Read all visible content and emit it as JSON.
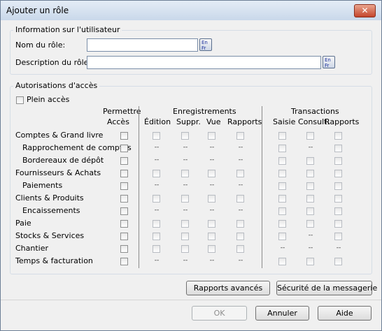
{
  "window": {
    "title": "Ajouter un rôle",
    "close_label": "✕"
  },
  "user_info": {
    "legend": "Information sur l'utilisateur",
    "role_name_label": "Nom du rôle:",
    "role_name_value": "",
    "role_desc_label": "Description du rôle:",
    "role_desc_value": "",
    "lang_button_text": "En Fr"
  },
  "permissions": {
    "legend": "Autorisations d'accès",
    "full_access_label": "Plein accès",
    "headers": {
      "permit_line1": "Permettre",
      "permit_line2": "Accès",
      "records_group": "Enregistrements",
      "records_cols": [
        "Édition",
        "Suppr.",
        "Vue",
        "Rapports"
      ],
      "transactions_group": "Transactions",
      "transactions_cols": [
        "Saisie",
        "Consult.",
        "Rapports"
      ]
    },
    "dash": "--",
    "rows": [
      {
        "label": "Comptes & Grand livre",
        "indent": false,
        "rec": [
          "cb",
          "cb",
          "cb",
          "cb"
        ],
        "tx": [
          "cb",
          "cb",
          "cb"
        ]
      },
      {
        "label": "Rapprochement de comptes",
        "indent": true,
        "rec": [
          "--",
          "--",
          "--",
          "--"
        ],
        "tx": [
          "cb",
          "--",
          "cb"
        ]
      },
      {
        "label": "Bordereaux de dépôt",
        "indent": true,
        "rec": [
          "--",
          "--",
          "--",
          "--"
        ],
        "tx": [
          "cb",
          "cb",
          "cb"
        ]
      },
      {
        "label": "Fournisseurs & Achats",
        "indent": false,
        "rec": [
          "cb",
          "cb",
          "cb",
          "cb"
        ],
        "tx": [
          "cb",
          "cb",
          "cb"
        ]
      },
      {
        "label": "Paiements",
        "indent": true,
        "rec": [
          "--",
          "--",
          "--",
          "--"
        ],
        "tx": [
          "cb",
          "cb",
          "cb"
        ]
      },
      {
        "label": "Clients & Produits",
        "indent": false,
        "rec": [
          "cb",
          "cb",
          "cb",
          "cb"
        ],
        "tx": [
          "cb",
          "cb",
          "cb"
        ]
      },
      {
        "label": "Encaissements",
        "indent": true,
        "rec": [
          "--",
          "--",
          "--",
          "--"
        ],
        "tx": [
          "cb",
          "cb",
          "cb"
        ]
      },
      {
        "label": "Paie",
        "indent": false,
        "rec": [
          "cb",
          "cb",
          "cb",
          "cb"
        ],
        "tx": [
          "cb",
          "cb",
          "cb"
        ]
      },
      {
        "label": "Stocks & Services",
        "indent": false,
        "rec": [
          "cb",
          "cb",
          "cb",
          "cb"
        ],
        "tx": [
          "cb",
          "--",
          "cb"
        ]
      },
      {
        "label": "Chantier",
        "indent": false,
        "rec": [
          "cb",
          "cb",
          "cb",
          "cb"
        ],
        "tx": [
          "--",
          "--",
          "--"
        ]
      },
      {
        "label": "Temps & facturation",
        "indent": false,
        "rec": [
          "--",
          "--",
          "--",
          "--"
        ],
        "tx": [
          "cb",
          "cb",
          "cb"
        ]
      }
    ]
  },
  "buttons": {
    "advanced_reports": "Rapports avancés",
    "messaging_security": "Sécurité de la messagerie",
    "ok": "OK",
    "cancel": "Annuler",
    "help": "Aide"
  }
}
